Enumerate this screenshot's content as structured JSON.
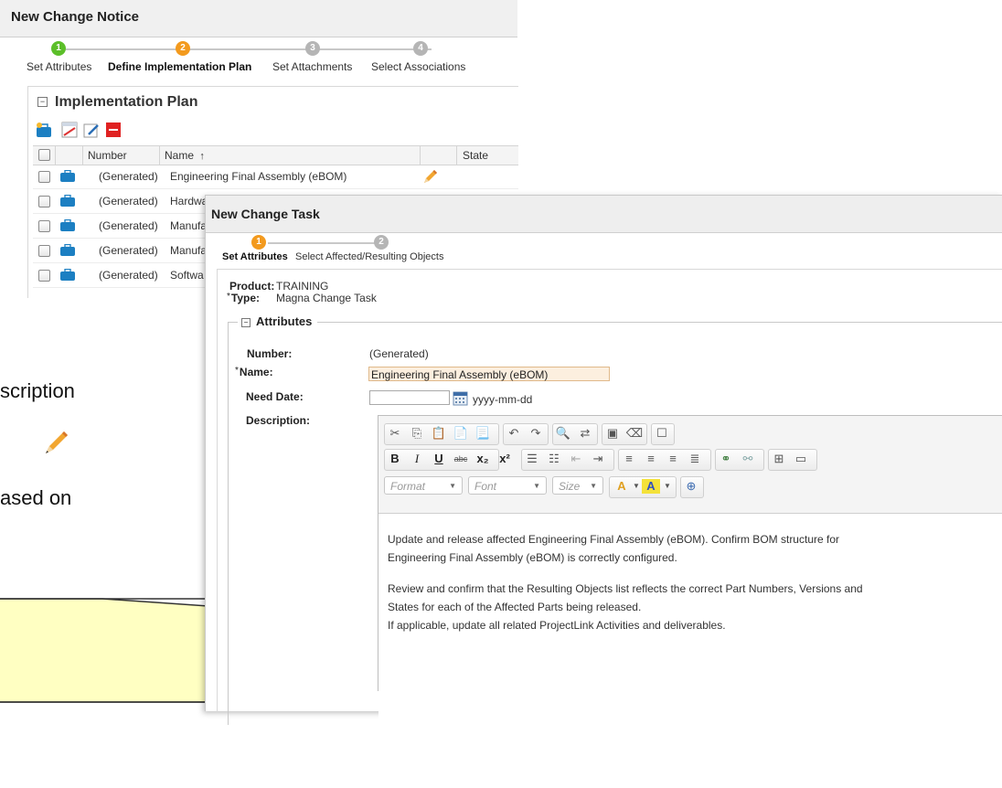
{
  "background": {
    "fragment_1": "scription",
    "fragment_2": "ased on"
  },
  "notice": {
    "title": "New Change Notice",
    "steps": [
      {
        "number": "1",
        "label": "Set Attributes",
        "color": "#5cbf2a"
      },
      {
        "number": "2",
        "label": "Define Implementation Plan",
        "color": "#f39a1e"
      },
      {
        "number": "3",
        "label": "Set Attachments",
        "color": "#b5b5b5"
      },
      {
        "number": "4",
        "label": "Select Associations",
        "color": "#b5b5b5"
      }
    ],
    "panel_title": "Implementation Plan",
    "columns": {
      "number": "Number",
      "name": "Name",
      "sort_indicator": "↑",
      "state": "State"
    },
    "rows": [
      {
        "number": "(Generated)",
        "name": "Engineering Final Assembly (eBOM)"
      },
      {
        "number": "(Generated)",
        "name": "Hardwa"
      },
      {
        "number": "(Generated)",
        "name": "Manufa"
      },
      {
        "number": "(Generated)",
        "name": "Manufa"
      },
      {
        "number": "(Generated)",
        "name": "Softwa"
      }
    ]
  },
  "task": {
    "title": "New Change Task",
    "steps": [
      {
        "number": "1",
        "label": "Set Attributes",
        "color": "#f39a1e"
      },
      {
        "number": "2",
        "label": "Select Affected/Resulting Objects",
        "color": "#b5b5b5"
      }
    ],
    "product_label": "Product:",
    "product_value": "TRAINING",
    "type_label": "Type:",
    "type_value": "Magna Change Task",
    "required_mark": "*",
    "attributes_title": "Attributes",
    "number_label": "Number:",
    "number_value": "(Generated)",
    "name_label": "Name:",
    "name_value": "Engineering Final Assembly (eBOM)",
    "need_date_label": "Need Date:",
    "need_date_value": "",
    "date_format": "yyyy-mm-dd",
    "description_label": "Description:",
    "editor": {
      "format_label": "Format",
      "font_label": "Font",
      "size_label": "Size",
      "paragraphs": [
        "Update and release affected Engineering Final Assembly (eBOM). Confirm BOM structure for",
        "Engineering Final Assembly (eBOM) is correctly configured.",
        "Review and confirm that the Resulting Objects list reflects the correct Part Numbers, Versions and",
        "States for each of the Affected Parts being released.",
        "If applicable, update all related ProjectLink Activities and deliverables."
      ]
    }
  }
}
